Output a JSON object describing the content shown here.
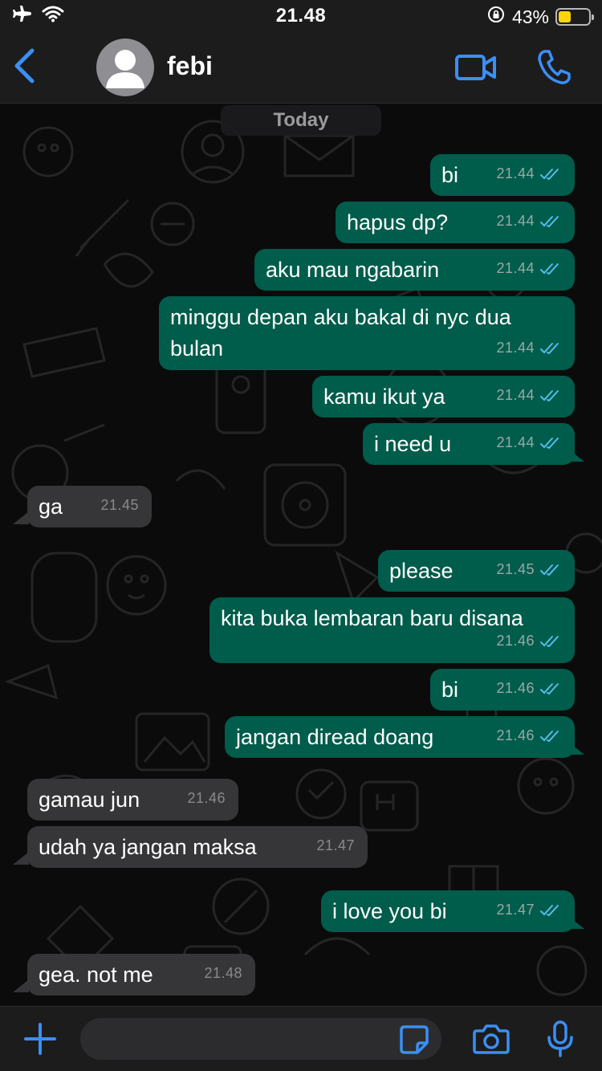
{
  "status_bar": {
    "time": "21.48",
    "battery_percent": "43%",
    "battery_level": 0.43,
    "battery_color": "#ffd60a"
  },
  "header": {
    "contact_name": "febi",
    "icons": [
      "back-chevron-icon",
      "avatar",
      "video-call-icon",
      "phone-call-icon"
    ],
    "accent_color": "#3b8ff5"
  },
  "chat": {
    "date_label": "Today",
    "messages": [
      {
        "dir": "out",
        "text": "bi",
        "time": "21.44",
        "read": true
      },
      {
        "dir": "out",
        "text": "hapus dp?",
        "time": "21.44",
        "read": true
      },
      {
        "dir": "out",
        "text": "aku mau ngabarin",
        "time": "21.44",
        "read": true
      },
      {
        "dir": "out",
        "text": "minggu depan aku bakal di nyc dua bulan",
        "time": "21.44",
        "read": true
      },
      {
        "dir": "out",
        "text": "kamu ikut ya",
        "time": "21.44",
        "read": true
      },
      {
        "dir": "out",
        "text": "i need u",
        "time": "21.44",
        "read": true
      },
      {
        "dir": "in",
        "text": "ga",
        "time": "21.45"
      },
      {
        "dir": "out",
        "text": "please",
        "time": "21.45",
        "read": true
      },
      {
        "dir": "out",
        "text": "kita buka lembaran baru disana",
        "time": "21.46",
        "read": true
      },
      {
        "dir": "out",
        "text": "bi",
        "time": "21.46",
        "read": true
      },
      {
        "dir": "out",
        "text": "jangan diread doang",
        "time": "21.46",
        "read": true
      },
      {
        "dir": "in",
        "text": "gamau jun",
        "time": "21.46"
      },
      {
        "dir": "in",
        "text": "udah ya jangan maksa",
        "time": "21.47"
      },
      {
        "dir": "out",
        "text": "i love you bi",
        "time": "21.47",
        "read": true
      },
      {
        "dir": "in",
        "text": "gea. not me",
        "time": "21.48"
      }
    ],
    "outgoing_color": "#005c4b",
    "incoming_color": "#363638",
    "read_tick_color": "#53bdeb"
  },
  "composer": {
    "value": "",
    "icons": [
      "plus-icon",
      "sticker-icon",
      "camera-icon",
      "microphone-icon"
    ]
  }
}
